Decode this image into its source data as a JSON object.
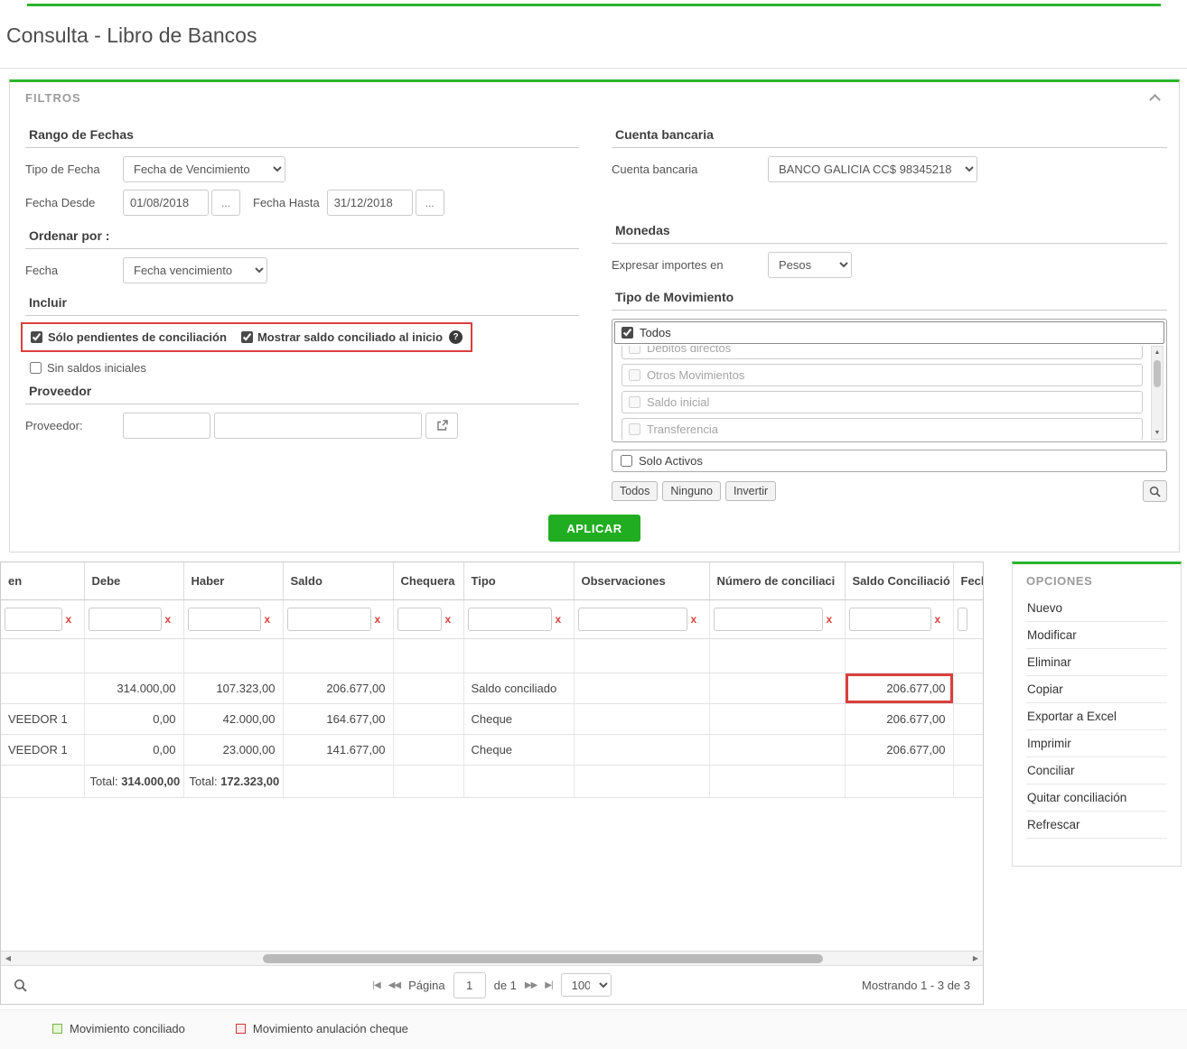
{
  "colors": {
    "accent": "#2cb52c",
    "highlight": "#d9403c",
    "apply_button": "#21ad21"
  },
  "page": {
    "title": "Consulta - Libro de Bancos"
  },
  "icons": {
    "first": "|◀",
    "prev": "◀◀",
    "next": "▶▶",
    "last": "▶|",
    "arrow_left": "◀",
    "arrow_right": "▶",
    "arrow_up": "▲",
    "arrow_down": "▼",
    "help": "?",
    "dots": "...",
    "clear": "x"
  },
  "filters": {
    "panel_title": "FILTROS",
    "date_range": {
      "section_title": "Rango de Fechas",
      "tipo_label": "Tipo de Fecha",
      "tipo_value": "Fecha de Vencimiento",
      "desde_label": "Fecha Desde",
      "desde_value": "01/08/2018",
      "hasta_label": "Fecha Hasta",
      "hasta_value": "31/12/2018"
    },
    "order": {
      "section_title": "Ordenar por :",
      "label": "Fecha",
      "value": "Fecha vencimiento"
    },
    "include": {
      "section_title": "Incluir",
      "cb_pendientes": {
        "label": "Sólo pendientes de conciliación",
        "checked": true
      },
      "cb_mostrar": {
        "label": "Mostrar saldo conciliado al inicio",
        "checked": true
      },
      "cb_sin_saldos": {
        "label": "Sin saldos iniciales",
        "checked": false
      }
    },
    "supplier": {
      "section_title": "Proveedor",
      "label": "Proveedor:",
      "code_value": "",
      "name_value": ""
    },
    "bank": {
      "section_title": "Cuenta bancaria",
      "label": "Cuenta bancaria",
      "value": "BANCO GALICIA CC$ 98345218"
    },
    "currency": {
      "section_title": "Monedas",
      "label": "Expresar importes en",
      "value": "Pesos"
    },
    "movement": {
      "section_title": "Tipo de Movimiento",
      "todos": {
        "label": "Todos",
        "checked": true
      },
      "items": [
        {
          "label": "Débitos directos",
          "checked": false
        },
        {
          "label": "Otros Movimientos",
          "checked": false
        },
        {
          "label": "Saldo inicial",
          "checked": false
        },
        {
          "label": "Transferencia",
          "checked": false
        }
      ],
      "solo_activos": {
        "label": "Solo Activos",
        "checked": false
      },
      "btn_todos": "Todos",
      "btn_ninguno": "Ninguno",
      "btn_invertir": "Invertir"
    },
    "apply_label": "APLICAR"
  },
  "grid": {
    "columns": [
      "en",
      "Debe",
      "Haber",
      "Saldo",
      "Chequera",
      "Tipo",
      "Observaciones",
      "Número de conciliaci",
      "Saldo Conciliació",
      "Fech"
    ],
    "rows": [
      {
        "origen": "",
        "debe": "314.000,00",
        "haber": "107.323,00",
        "saldo": "206.677,00",
        "chequera": "",
        "tipo": "Saldo conciliado",
        "observaciones": "",
        "numero": "",
        "saldo_conciliacion": "206.677,00"
      },
      {
        "origen": "VEEDOR 1",
        "debe": "0,00",
        "haber": "42.000,00",
        "saldo": "164.677,00",
        "chequera": "",
        "tipo": "Cheque",
        "observaciones": "",
        "numero": "",
        "saldo_conciliacion": "206.677,00"
      },
      {
        "origen": "VEEDOR 1",
        "debe": "0,00",
        "haber": "23.000,00",
        "saldo": "141.677,00",
        "chequera": "",
        "tipo": "Cheque",
        "observaciones": "",
        "numero": "",
        "saldo_conciliacion": "206.677,00"
      }
    ],
    "totals": {
      "label": "Total:",
      "debe": "314.000,00",
      "haber": "172.323,00"
    }
  },
  "pager": {
    "pagina_label": "Página",
    "page_value": "1",
    "of_label": "de 1",
    "page_size": "100",
    "showing": "Mostrando 1 - 3 de 3"
  },
  "options": {
    "title": "OPCIONES",
    "items": [
      "Nuevo",
      "Modificar",
      "Eliminar",
      "Copiar",
      "Exportar a Excel",
      "Imprimir",
      "Conciliar",
      "Quitar conciliación",
      "Refrescar"
    ]
  },
  "legend": {
    "conciliado": "Movimiento conciliado",
    "anulacion": "Movimiento anulación cheque"
  }
}
